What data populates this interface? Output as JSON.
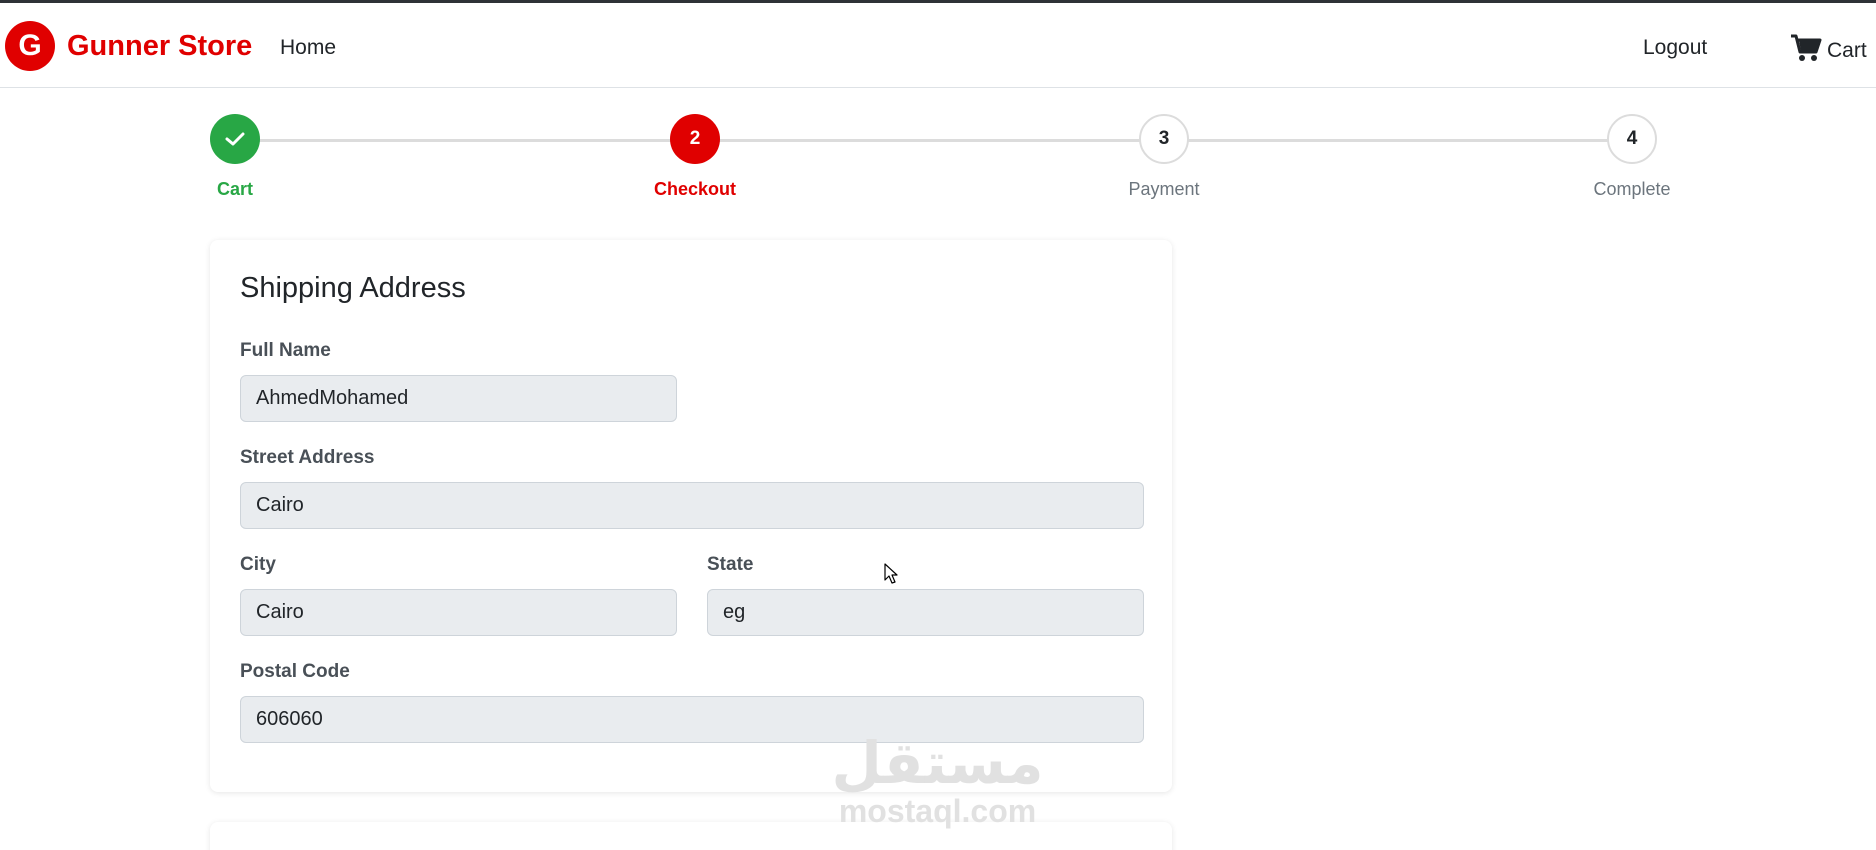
{
  "navbar": {
    "logo_letter": "G",
    "brand_name": "Gunner Store",
    "home_label": "Home",
    "logout_label": "Logout",
    "cart_label": "Cart",
    "brand_color": "#e00000"
  },
  "steps": [
    {
      "number": "1",
      "label": "Cart",
      "state": "done",
      "icon": "check-icon"
    },
    {
      "number": "2",
      "label": "Checkout",
      "state": "active"
    },
    {
      "number": "3",
      "label": "Payment",
      "state": "todo"
    },
    {
      "number": "4",
      "label": "Complete",
      "state": "todo"
    }
  ],
  "shipping": {
    "title": "Shipping Address",
    "full_name": {
      "label": "Full Name",
      "value": "AhmedMohamed"
    },
    "street": {
      "label": "Street Address",
      "value": "Cairo"
    },
    "city": {
      "label": "City",
      "value": "Cairo"
    },
    "state": {
      "label": "State",
      "value": "eg"
    },
    "postal": {
      "label": "Postal Code",
      "value": "606060"
    }
  },
  "watermark": {
    "arabic": "مستقل",
    "latin": "mostaql.com"
  },
  "colors": {
    "success": "#28a745",
    "active": "#e00000",
    "input_bg": "#e9ecef"
  }
}
